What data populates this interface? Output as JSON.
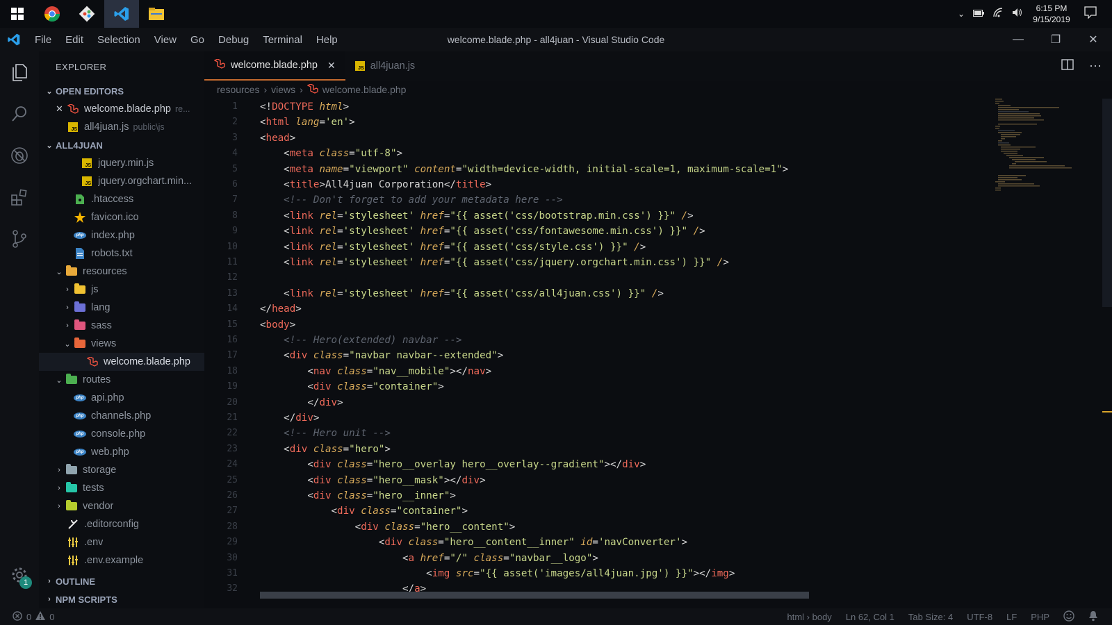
{
  "taskbar": {
    "apps": [
      {
        "icon": "windows-start-icon"
      },
      {
        "icon": "chrome-icon"
      },
      {
        "icon": "git-icon"
      },
      {
        "icon": "vscode-icon"
      },
      {
        "icon": "file-explorer-icon"
      }
    ],
    "time": "6:15 PM",
    "date": "9/15/2019"
  },
  "menubar": {
    "items": [
      "File",
      "Edit",
      "Selection",
      "View",
      "Go",
      "Debug",
      "Terminal",
      "Help"
    ],
    "title": "welcome.blade.php - all4juan - Visual Studio Code"
  },
  "sidebar": {
    "title": "EXPLORER",
    "open_editors_label": "OPEN EDITORS",
    "open_editors": [
      {
        "name": "welcome.blade.php",
        "desc": "re..."
      },
      {
        "name": "all4juan.js",
        "desc": "public\\js"
      }
    ],
    "project_label": "ALL4JUAN",
    "files": [
      {
        "name": "jquery.min.js"
      },
      {
        "name": "jquery.orgchart.min..."
      },
      {
        "name": ".htaccess"
      },
      {
        "name": "favicon.ico"
      },
      {
        "name": "index.php"
      },
      {
        "name": "robots.txt"
      },
      {
        "name": "resources"
      },
      {
        "name": "js"
      },
      {
        "name": "lang"
      },
      {
        "name": "sass"
      },
      {
        "name": "views"
      },
      {
        "name": "welcome.blade.php"
      },
      {
        "name": "routes"
      },
      {
        "name": "api.php"
      },
      {
        "name": "channels.php"
      },
      {
        "name": "console.php"
      },
      {
        "name": "web.php"
      },
      {
        "name": "storage"
      },
      {
        "name": "tests"
      },
      {
        "name": "vendor"
      },
      {
        "name": ".editorconfig"
      },
      {
        "name": ".env"
      },
      {
        "name": ".env.example"
      }
    ],
    "outline_label": "OUTLINE",
    "npm_label": "NPM SCRIPTS",
    "settings_badge": "1"
  },
  "editor": {
    "tabs": [
      {
        "label": "welcome.blade.php",
        "active": true
      },
      {
        "label": "all4juan.js",
        "active": false
      }
    ],
    "breadcrumb": [
      "resources",
      "views",
      "welcome.blade.php"
    ],
    "line_numbers": [
      "1",
      "2",
      "3",
      "4",
      "5",
      "6",
      "7",
      "8",
      "9",
      "10",
      "11",
      "12",
      "13",
      "14",
      "15",
      "16",
      "17",
      "18",
      "19",
      "20",
      "21",
      "22",
      "23",
      "24",
      "25",
      "26",
      "27",
      "28",
      "29",
      "30",
      "31",
      "32"
    ],
    "code_lines": [
      "<!DOCTYPE html>",
      "<html lang='en'>",
      "<head>",
      "    <meta class=\"utf-8\">",
      "    <meta name=\"viewport\" content=\"width=device-width, initial-scale=1, maximum-scale=1\">",
      "    <title>All4juan Corporation</title>",
      "    <!-- Don't forget to add your metadata here -->",
      "    <link rel='stylesheet' href=\"{{ asset('css/bootstrap.min.css') }}\" />",
      "    <link rel='stylesheet' href=\"{{ asset('css/fontawesome.min.css') }}\" />",
      "    <link rel='stylesheet' href=\"{{ asset('css/style.css') }}\" />",
      "    <link rel='stylesheet' href=\"{{ asset('css/jquery.orgchart.min.css') }}\" />",
      "",
      "    <link rel='stylesheet' href=\"{{ asset('css/all4juan.css') }}\" />",
      "</head>",
      "<body>",
      "    <!-- Hero(extended) navbar -->",
      "    <div class=\"navbar navbar--extended\">",
      "        <nav class=\"nav__mobile\"></nav>",
      "        <div class=\"container\">",
      "        </div>",
      "    </div>",
      "    <!-- Hero unit -->",
      "    <div class=\"hero\">",
      "        <div class=\"hero__overlay hero__overlay--gradient\"></div>",
      "        <div class=\"hero__mask\"></div>",
      "        <div class=\"hero__inner\">",
      "            <div class=\"container\">",
      "                <div class=\"hero__content\">",
      "                    <div class=\"hero__content__inner\" id='navConverter'>",
      "                        <a href=\"/\" class=\"navbar__logo\">",
      "                            <img src=\"{{ asset('images/all4juan.jpg') }}\"></img>",
      "                        </a>"
    ]
  },
  "status": {
    "errors": "0",
    "warnings": "0",
    "scope": "html › body",
    "position": "Ln 62, Col 1",
    "tab_size": "Tab Size: 4",
    "encoding": "UTF-8",
    "eol": "LF",
    "language": "PHP"
  },
  "colors": {
    "accent_tab": "#c46a2e",
    "tag": "#ef6a5a",
    "attribute": "#d8aa5a",
    "string": "#c7d68a",
    "comment": "#5f6570",
    "badge": "#1e8a7c"
  }
}
